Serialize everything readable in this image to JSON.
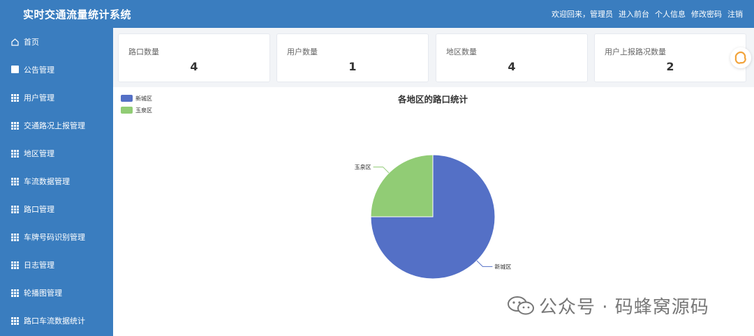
{
  "header": {
    "title": "实时交通流量统计系统",
    "welcome": "欢迎回来，管理员",
    "links": [
      "进入前台",
      "个人信息",
      "修改密码",
      "注销"
    ]
  },
  "sidebar": {
    "items": [
      {
        "label": "首页",
        "icon": "home-icon"
      },
      {
        "label": "公告管理",
        "icon": "chat-icon"
      },
      {
        "label": "用户管理",
        "icon": "grid-icon"
      },
      {
        "label": "交通路况上报管理",
        "icon": "grid-icon"
      },
      {
        "label": "地区管理",
        "icon": "grid-icon"
      },
      {
        "label": "车流数据管理",
        "icon": "grid-icon"
      },
      {
        "label": "路口管理",
        "icon": "grid-icon"
      },
      {
        "label": "车牌号码识别管理",
        "icon": "grid-icon"
      },
      {
        "label": "日志管理",
        "icon": "grid-icon"
      },
      {
        "label": "轮播图管理",
        "icon": "grid-icon"
      },
      {
        "label": "路口车流数据统计",
        "icon": "grid-icon"
      }
    ]
  },
  "cards": [
    {
      "label": "路口数量",
      "value": "4"
    },
    {
      "label": "用户数量",
      "value": "1"
    },
    {
      "label": "地区数量",
      "value": "4"
    },
    {
      "label": "用户上报路况数量",
      "value": "2"
    }
  ],
  "chart_data": {
    "type": "pie",
    "title": "各地区的路口统计",
    "legend_position": "top-left",
    "series": [
      {
        "name": "新城区",
        "value": 3,
        "color": "#5470c6"
      },
      {
        "name": "玉泉区",
        "value": 1,
        "color": "#91cc75"
      }
    ]
  },
  "watermark": "公众号 · 码蜂窝源码",
  "colors": {
    "primary": "#3a7dbf",
    "background": "#f2f4f7"
  }
}
